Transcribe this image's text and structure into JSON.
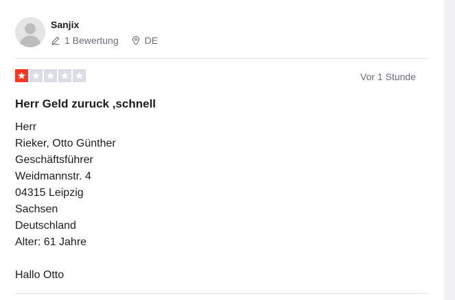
{
  "review": {
    "user": {
      "name": "Sanjix",
      "reviews_count_label": "1 Bewertung",
      "country": "DE"
    },
    "rating": {
      "value": 1,
      "max": 5
    },
    "date": "Vor 1 Stunde",
    "title": "Herr Geld zuruck ,schnell",
    "body_lines": [
      "Herr",
      "Rieker, Otto Günther",
      "Geschäftsführer",
      "Weidmannstr. 4",
      "04315 Leipzig",
      "Sachsen",
      "Deutschland",
      "Alter: 61 Jahre",
      "",
      "Hallo Otto"
    ]
  },
  "colors": {
    "star_filled": "#ff3722",
    "star_empty": "#dcdce6",
    "text": "#1c1c1c",
    "muted": "#6b6b75"
  },
  "icons": {
    "avatar": "user-silhouette-icon",
    "reviews": "pencil-icon",
    "location": "location-pin-icon",
    "star": "star-icon"
  }
}
